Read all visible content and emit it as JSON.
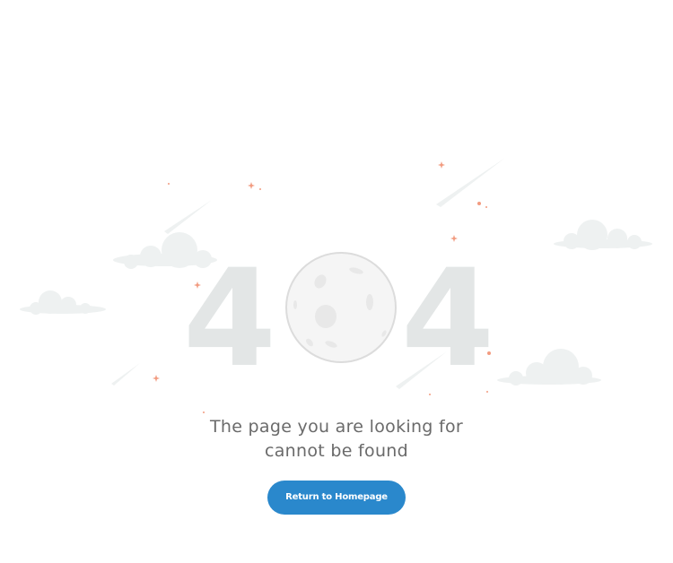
{
  "error": {
    "code_left": "4",
    "code_right": "4",
    "message_line1": "The page you are looking for",
    "message_line2": "cannot be found"
  },
  "actions": {
    "home_button_label": "Return to Homepage"
  },
  "colors": {
    "accent": "#2a88cc",
    "digits": "#e3e6e6",
    "clouds": "#eef1f1",
    "moon": "#f5f5f5",
    "stars": "#f29b80",
    "text": "#6a6a6a"
  }
}
